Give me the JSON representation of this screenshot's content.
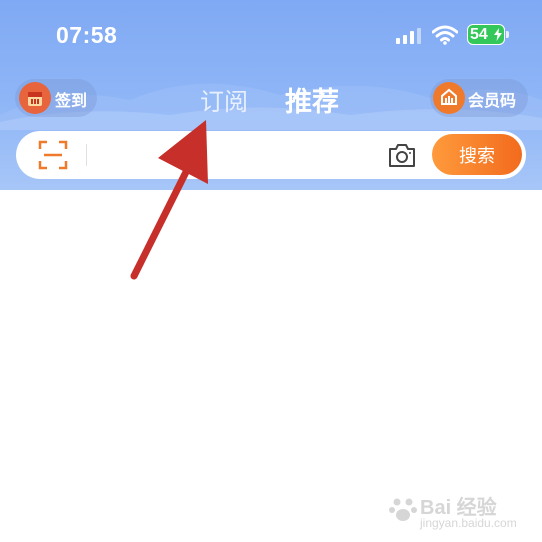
{
  "status_bar": {
    "time": "07:58",
    "battery_level": "54",
    "icons": [
      "signal-icon",
      "wifi-icon",
      "battery-icon",
      "charging-bolt-icon"
    ]
  },
  "header": {
    "checkin_label": "签到",
    "tabs": [
      {
        "label": "订阅",
        "active": false
      },
      {
        "label": "推荐",
        "active": true
      }
    ],
    "member_code_label": "会员码"
  },
  "search": {
    "placeholder": "",
    "value": "",
    "button_label": "搜索",
    "icons": [
      "scan-icon",
      "camera-icon"
    ]
  },
  "annotation": {
    "type": "arrow",
    "color": "#c62f2a",
    "points_to": "tab-subscribe"
  },
  "watermark": {
    "brand": "Bai 经验",
    "sub": "jingyan.baidu.com"
  },
  "colors": {
    "header_gradient_top": "#7fa9f4",
    "search_button": "#f26b1d",
    "arrow": "#c62f2a"
  }
}
